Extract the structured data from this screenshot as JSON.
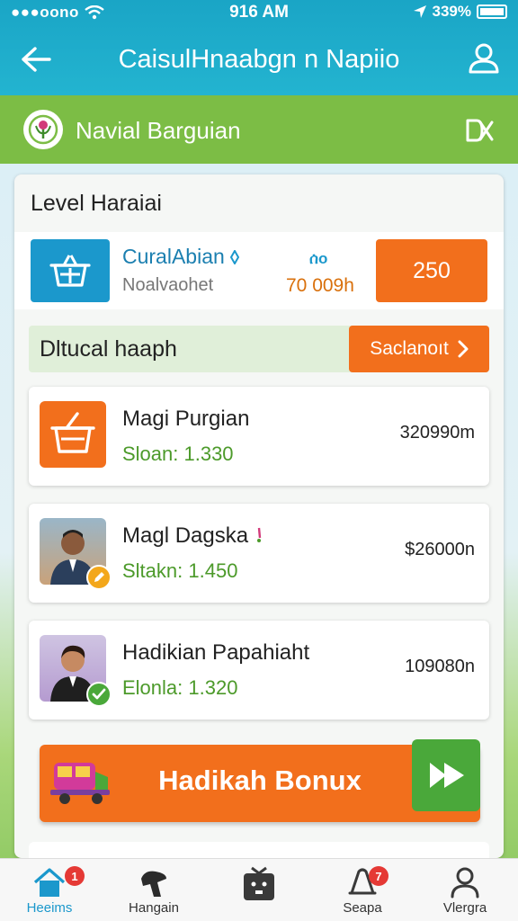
{
  "status": {
    "signal": "●●●oono",
    "time": "916 AM",
    "battery": "339%"
  },
  "header": {
    "title": "CaisulHnaabgn n Napiio"
  },
  "subheader": {
    "title": "Navial Barguian"
  },
  "card": {
    "title": "Level Haraiai",
    "summary": {
      "name": "CuralAbian",
      "subtitle": "Noalvaohet",
      "mid_top": "ሰo",
      "mid_bottom": "70 009h",
      "button": "250"
    },
    "section": {
      "title": "Dltucal haaph",
      "button": "Saclanoıt"
    },
    "items": [
      {
        "name": "Magi Purgian",
        "stat": "Sloan: 1.330",
        "value": "320990m"
      },
      {
        "name": "Magl Dagska",
        "stat": "Sltakn: 1.450",
        "value": "$26000n"
      },
      {
        "name": "Hadikian Papahiaht",
        "stat": "Elonla: 1.320",
        "value": "109080n"
      }
    ],
    "bonus": {
      "label": "Hadikah Bonux"
    }
  },
  "tabs": [
    {
      "label": "Heeims",
      "badge": "1"
    },
    {
      "label": "Hangain",
      "badge": ""
    },
    {
      "label": "",
      "badge": ""
    },
    {
      "label": "Seapa",
      "badge": "7"
    },
    {
      "label": "Vlergra",
      "badge": ""
    }
  ],
  "colors": {
    "header": "#1aa5c6",
    "subheader": "#7cbd45",
    "accent_orange": "#f26f1c",
    "accent_blue": "#1b98cc",
    "accent_green": "#4c9a2a"
  }
}
